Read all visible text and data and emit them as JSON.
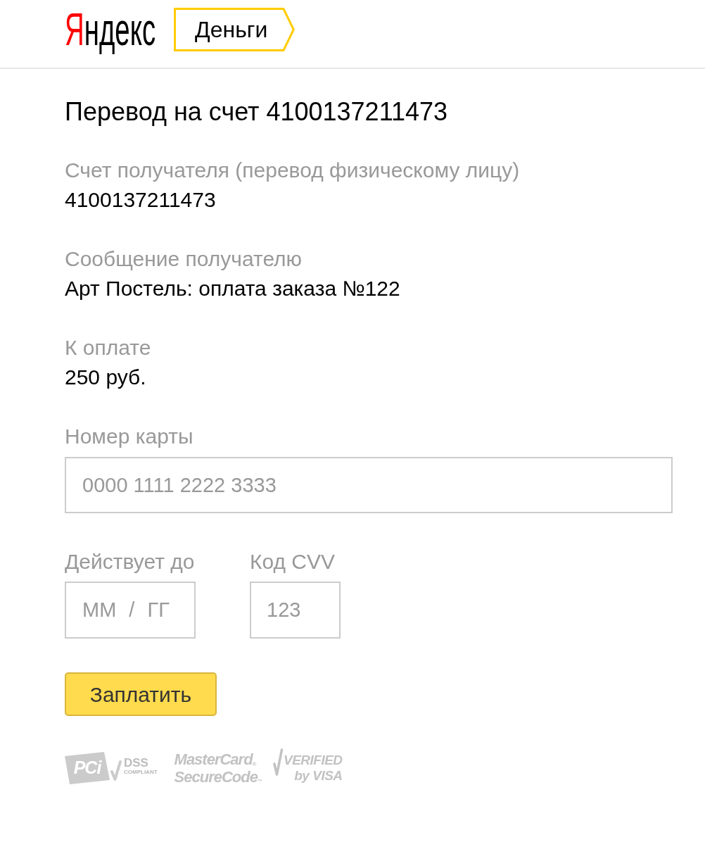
{
  "header": {
    "logo": {
      "initial": "Я",
      "rest": "ндекс"
    },
    "service_link": "Деньги"
  },
  "title": "Перевод на счет 4100137211473",
  "details": [
    {
      "label": "Счет получателя (перевод физическому лицу)",
      "value": "4100137211473"
    },
    {
      "label": "Сообщение получателю",
      "value": "Арт Постель: оплата заказа №122"
    },
    {
      "label": "К оплате",
      "value": "250 руб."
    }
  ],
  "card_form": {
    "card_number": {
      "label": "Номер карты",
      "placeholder": "0000 1111 2222 3333"
    },
    "expiry": {
      "label": "Действует до",
      "placeholder": "ММ / ГГ"
    },
    "cvv": {
      "label": "Код CVV",
      "placeholder": "123"
    }
  },
  "pay_button": "Заплатить",
  "security_logos": [
    {
      "kind": "pci",
      "mark": "PCi",
      "lines": [
        "DSS",
        "COMPLIANT"
      ]
    },
    {
      "kind": "mastercard",
      "lines": [
        "MasterCard$_{®}$",
        "SecureCode$_{™}$"
      ]
    },
    {
      "kind": "visa",
      "lines": [
        "VERIFIED",
        "by VISA"
      ]
    }
  ]
}
